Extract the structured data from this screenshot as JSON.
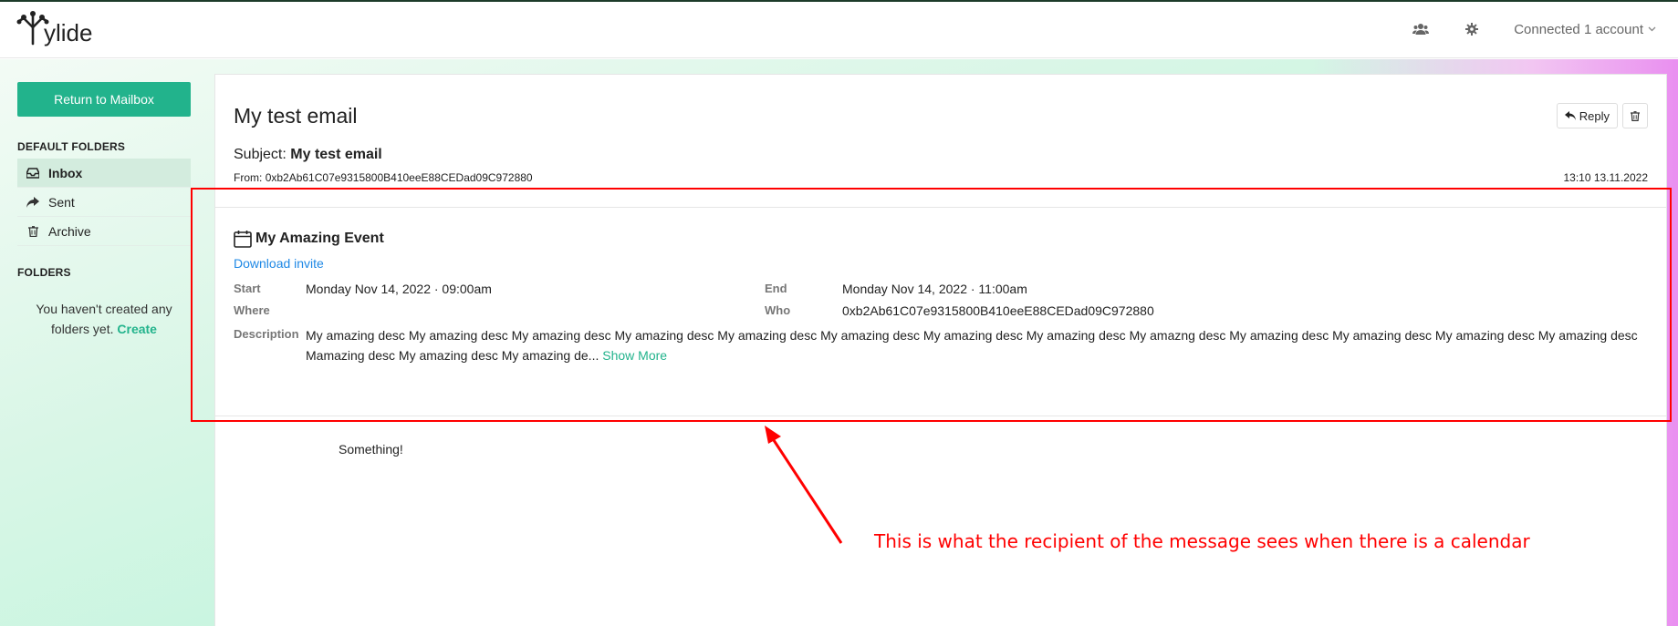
{
  "header": {
    "logo_text": "ylide",
    "account_label": "Connected 1 account",
    "icons": [
      "users-icon",
      "gear-icon",
      "chevron-down-icon"
    ]
  },
  "sidebar": {
    "return_label": "Return to Mailbox",
    "default_folders_title": "DEFAULT FOLDERS",
    "items": [
      {
        "label": "Inbox",
        "icon": "inbox-icon",
        "active": true
      },
      {
        "label": "Sent",
        "icon": "share-icon",
        "active": false
      },
      {
        "label": "Archive",
        "icon": "trash-icon",
        "active": false
      }
    ],
    "folders_title": "FOLDERS",
    "empty_line1": "You haven't created any",
    "empty_line2": "folders yet.",
    "create_label": "Create"
  },
  "email": {
    "title": "My test email",
    "reply_label": "Reply",
    "subject_label": "Subject:",
    "subject_value": "My test email",
    "from_label": "From:",
    "from_value": "0xb2Ab61C07e9315800B410eeE88CEDad09C972880",
    "date": "13:10 13.11.2022",
    "body": "Something!"
  },
  "event": {
    "title": "My Amazing Event",
    "download_label": "Download invite",
    "start_label": "Start",
    "start_value": "Monday Nov 14, 2022 · 09:00am",
    "end_label": "End",
    "end_value": "Monday Nov 14, 2022 · 11:00am",
    "where_label": "Where",
    "where_value": "",
    "who_label": "Who",
    "who_value": "0xb2Ab61C07e9315800B410eeE88CEDad09C972880",
    "description_label": "Description",
    "description_value": "My amazing desc My amazing desc My amazing desc My amazing desc My amazing desc My amazing desc My amazing desc My amazing desc My amazng desc My amazing desc My amazing desc My amazing desc My amazing desc Mamazing desc My amazing desc My amazing de...",
    "show_more_label": "Show More"
  },
  "annotation": {
    "text": "This is what the recipient of the message sees when there is a calendar",
    "color": "#ff0000"
  },
  "colors": {
    "accent": "#22b38c",
    "link": "#1e88e5"
  }
}
